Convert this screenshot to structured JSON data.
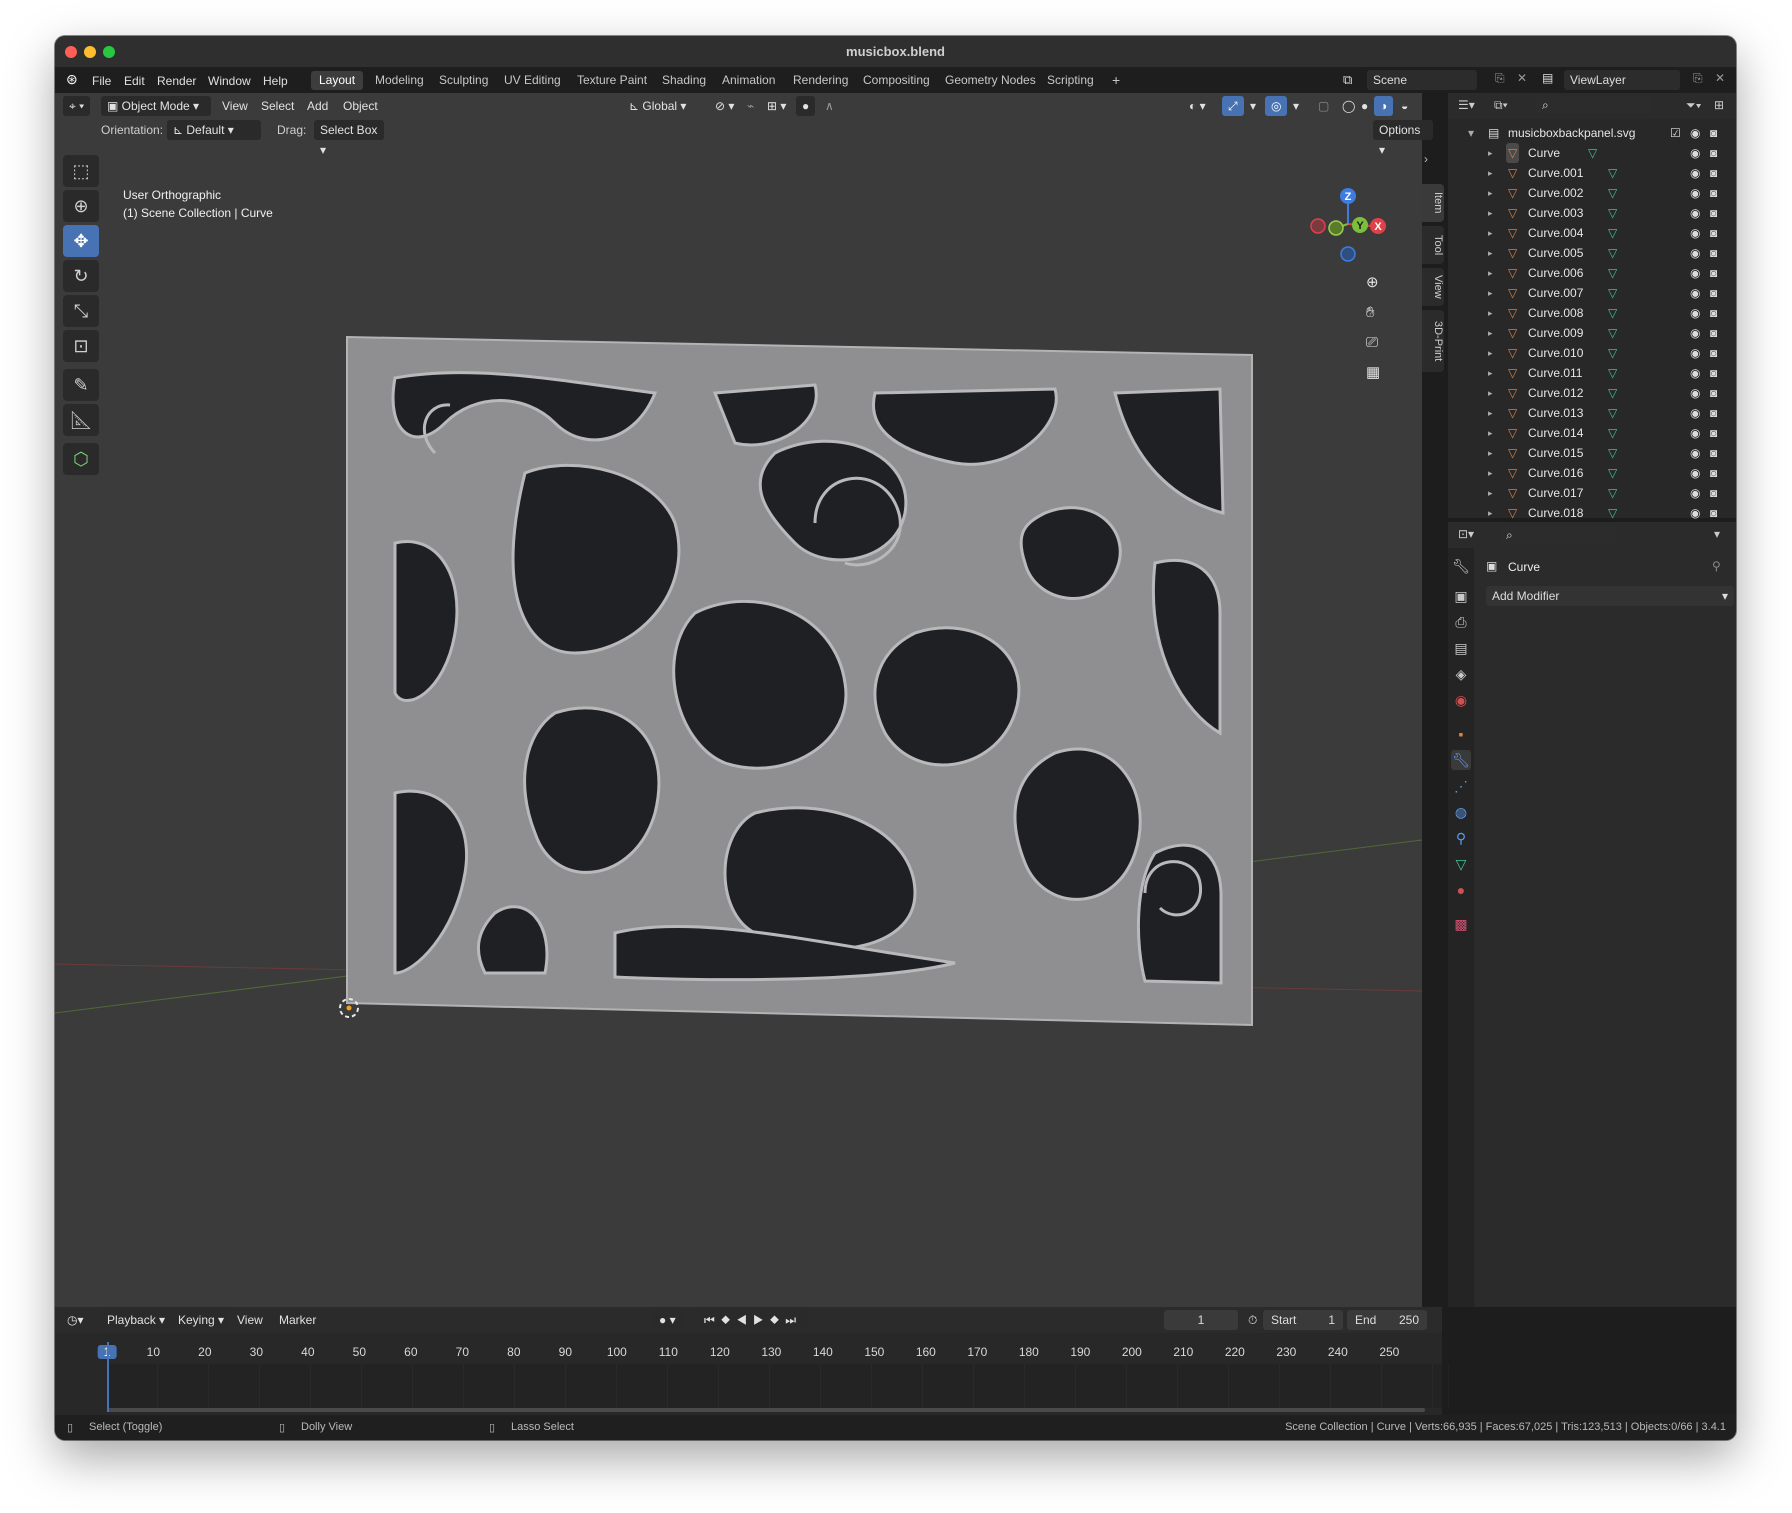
{
  "window": {
    "title": "musicbox.blend"
  },
  "menu": [
    "File",
    "Edit",
    "Render",
    "Window",
    "Help"
  ],
  "workspaces": [
    "Layout",
    "Modeling",
    "Sculpting",
    "UV Editing",
    "Texture Paint",
    "Shading",
    "Animation",
    "Rendering",
    "Compositing",
    "Geometry Nodes",
    "Scripting",
    "+"
  ],
  "scene": {
    "name": "Scene",
    "view_layer": "ViewLayer"
  },
  "viewport_header": {
    "mode": "Object Mode",
    "menus": [
      "View",
      "Select",
      "Add",
      "Object"
    ],
    "transform_orientation": "Global",
    "orientation_label": "Orientation:",
    "orientation_value": "Default",
    "drag_label": "Drag:",
    "drag_value": "Select Box",
    "options": "Options"
  },
  "viewport": {
    "view_name": "User Orthographic",
    "collection_info": "(1) Scene Collection | Curve",
    "side_tabs": [
      "Item",
      "Tool",
      "View",
      "3D-Print"
    ],
    "gizmo_axes": [
      "Z",
      "Y",
      "X"
    ]
  },
  "outliner": {
    "root": "musicboxbackpanel.svg",
    "items": [
      "Curve",
      "Curve.001",
      "Curve.002",
      "Curve.003",
      "Curve.004",
      "Curve.005",
      "Curve.006",
      "Curve.007",
      "Curve.008",
      "Curve.009",
      "Curve.010",
      "Curve.011",
      "Curve.012",
      "Curve.013",
      "Curve.014",
      "Curve.015",
      "Curve.016",
      "Curve.017",
      "Curve.018"
    ]
  },
  "properties": {
    "object_name": "Curve",
    "add_modifier": "Add Modifier"
  },
  "timeline": {
    "menus": [
      "Playback",
      "Keying",
      "View",
      "Marker"
    ],
    "current_frame": "1",
    "start_label": "Start",
    "start_value": "1",
    "end_label": "End",
    "end_value": "250",
    "ticks": [
      "1",
      "10",
      "20",
      "30",
      "40",
      "50",
      "60",
      "70",
      "80",
      "90",
      "100",
      "110",
      "120",
      "130",
      "140",
      "150",
      "160",
      "170",
      "180",
      "190",
      "200",
      "210",
      "220",
      "230",
      "240",
      "250"
    ]
  },
  "statusbar": {
    "hint_select": "Select (Toggle)",
    "hint_dolly": "Dolly View",
    "hint_lasso": "Lasso Select",
    "stats": "Scene Collection | Curve | Verts:66,935 | Faces:67,025 | Tris:123,513 | Objects:0/66 | 3.4.1"
  },
  "colors": {
    "accent": "#4772b3",
    "viewport_bg": "#3b3b3b",
    "panel_bg": "#cfcfcf",
    "mesh_icon": "#e0813a",
    "data_icon": "#3fc58f"
  }
}
